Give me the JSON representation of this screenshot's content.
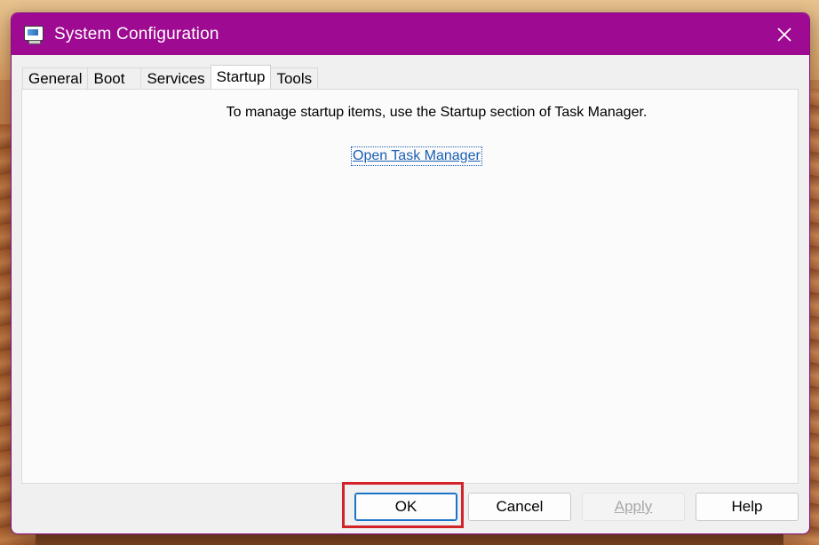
{
  "window": {
    "title": "System Configuration",
    "icon": "msconfig-app-icon",
    "close_icon": "close-icon"
  },
  "tabs": [
    {
      "label": "General",
      "active": false
    },
    {
      "label": "Boot",
      "active": false
    },
    {
      "label": "Services",
      "active": false
    },
    {
      "label": "Startup",
      "active": true
    },
    {
      "label": "Tools",
      "active": false
    }
  ],
  "startup": {
    "message": "To manage startup items, use the Startup section of Task Manager.",
    "link_label": "Open Task Manager"
  },
  "buttons": {
    "ok": "OK",
    "cancel": "Cancel",
    "apply": "Apply",
    "help": "Help"
  },
  "colors": {
    "titlebar": "#9e0a91",
    "highlight": "#d2232a",
    "link": "#1a5fb4"
  }
}
